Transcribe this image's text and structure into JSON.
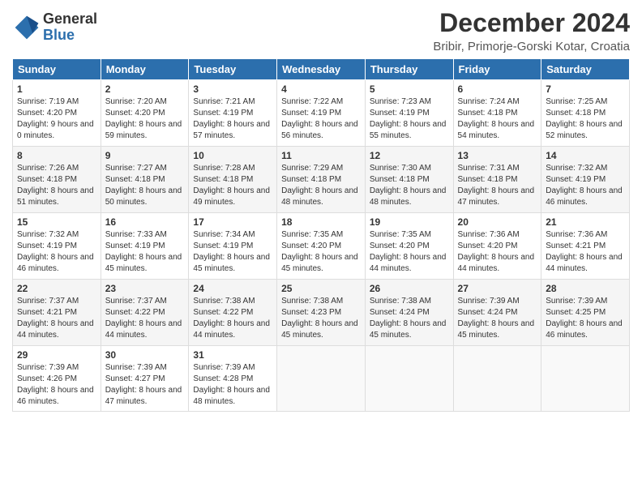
{
  "logo": {
    "general": "General",
    "blue": "Blue"
  },
  "title": "December 2024",
  "location": "Bribir, Primorje-Gorski Kotar, Croatia",
  "weekdays": [
    "Sunday",
    "Monday",
    "Tuesday",
    "Wednesday",
    "Thursday",
    "Friday",
    "Saturday"
  ],
  "weeks": [
    [
      {
        "day": "1",
        "sunrise": "7:19 AM",
        "sunset": "4:20 PM",
        "daylight": "9 hours and 0 minutes."
      },
      {
        "day": "2",
        "sunrise": "7:20 AM",
        "sunset": "4:20 PM",
        "daylight": "8 hours and 59 minutes."
      },
      {
        "day": "3",
        "sunrise": "7:21 AM",
        "sunset": "4:19 PM",
        "daylight": "8 hours and 57 minutes."
      },
      {
        "day": "4",
        "sunrise": "7:22 AM",
        "sunset": "4:19 PM",
        "daylight": "8 hours and 56 minutes."
      },
      {
        "day": "5",
        "sunrise": "7:23 AM",
        "sunset": "4:19 PM",
        "daylight": "8 hours and 55 minutes."
      },
      {
        "day": "6",
        "sunrise": "7:24 AM",
        "sunset": "4:18 PM",
        "daylight": "8 hours and 54 minutes."
      },
      {
        "day": "7",
        "sunrise": "7:25 AM",
        "sunset": "4:18 PM",
        "daylight": "8 hours and 52 minutes."
      }
    ],
    [
      {
        "day": "8",
        "sunrise": "7:26 AM",
        "sunset": "4:18 PM",
        "daylight": "8 hours and 51 minutes."
      },
      {
        "day": "9",
        "sunrise": "7:27 AM",
        "sunset": "4:18 PM",
        "daylight": "8 hours and 50 minutes."
      },
      {
        "day": "10",
        "sunrise": "7:28 AM",
        "sunset": "4:18 PM",
        "daylight": "8 hours and 49 minutes."
      },
      {
        "day": "11",
        "sunrise": "7:29 AM",
        "sunset": "4:18 PM",
        "daylight": "8 hours and 48 minutes."
      },
      {
        "day": "12",
        "sunrise": "7:30 AM",
        "sunset": "4:18 PM",
        "daylight": "8 hours and 48 minutes."
      },
      {
        "day": "13",
        "sunrise": "7:31 AM",
        "sunset": "4:18 PM",
        "daylight": "8 hours and 47 minutes."
      },
      {
        "day": "14",
        "sunrise": "7:32 AM",
        "sunset": "4:19 PM",
        "daylight": "8 hours and 46 minutes."
      }
    ],
    [
      {
        "day": "15",
        "sunrise": "7:32 AM",
        "sunset": "4:19 PM",
        "daylight": "8 hours and 46 minutes."
      },
      {
        "day": "16",
        "sunrise": "7:33 AM",
        "sunset": "4:19 PM",
        "daylight": "8 hours and 45 minutes."
      },
      {
        "day": "17",
        "sunrise": "7:34 AM",
        "sunset": "4:19 PM",
        "daylight": "8 hours and 45 minutes."
      },
      {
        "day": "18",
        "sunrise": "7:35 AM",
        "sunset": "4:20 PM",
        "daylight": "8 hours and 45 minutes."
      },
      {
        "day": "19",
        "sunrise": "7:35 AM",
        "sunset": "4:20 PM",
        "daylight": "8 hours and 44 minutes."
      },
      {
        "day": "20",
        "sunrise": "7:36 AM",
        "sunset": "4:20 PM",
        "daylight": "8 hours and 44 minutes."
      },
      {
        "day": "21",
        "sunrise": "7:36 AM",
        "sunset": "4:21 PM",
        "daylight": "8 hours and 44 minutes."
      }
    ],
    [
      {
        "day": "22",
        "sunrise": "7:37 AM",
        "sunset": "4:21 PM",
        "daylight": "8 hours and 44 minutes."
      },
      {
        "day": "23",
        "sunrise": "7:37 AM",
        "sunset": "4:22 PM",
        "daylight": "8 hours and 44 minutes."
      },
      {
        "day": "24",
        "sunrise": "7:38 AM",
        "sunset": "4:22 PM",
        "daylight": "8 hours and 44 minutes."
      },
      {
        "day": "25",
        "sunrise": "7:38 AM",
        "sunset": "4:23 PM",
        "daylight": "8 hours and 45 minutes."
      },
      {
        "day": "26",
        "sunrise": "7:38 AM",
        "sunset": "4:24 PM",
        "daylight": "8 hours and 45 minutes."
      },
      {
        "day": "27",
        "sunrise": "7:39 AM",
        "sunset": "4:24 PM",
        "daylight": "8 hours and 45 minutes."
      },
      {
        "day": "28",
        "sunrise": "7:39 AM",
        "sunset": "4:25 PM",
        "daylight": "8 hours and 46 minutes."
      }
    ],
    [
      {
        "day": "29",
        "sunrise": "7:39 AM",
        "sunset": "4:26 PM",
        "daylight": "8 hours and 46 minutes."
      },
      {
        "day": "30",
        "sunrise": "7:39 AM",
        "sunset": "4:27 PM",
        "daylight": "8 hours and 47 minutes."
      },
      {
        "day": "31",
        "sunrise": "7:39 AM",
        "sunset": "4:28 PM",
        "daylight": "8 hours and 48 minutes."
      },
      null,
      null,
      null,
      null
    ]
  ]
}
